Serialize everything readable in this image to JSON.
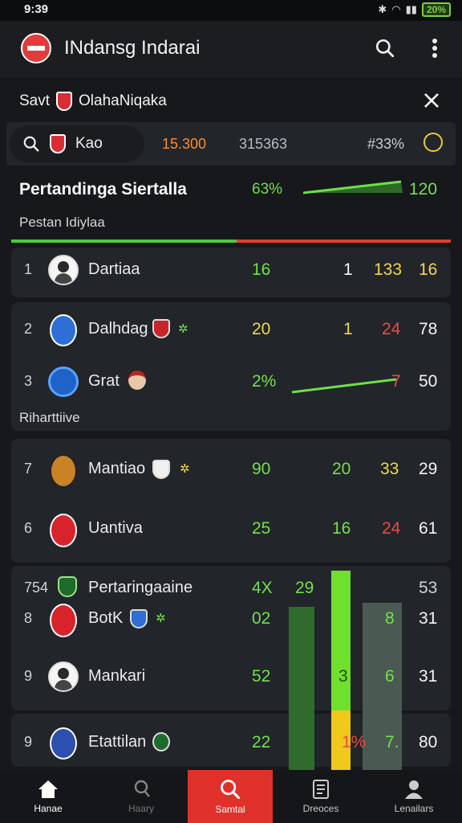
{
  "status_bar": {
    "time": "9:39",
    "battery": "20%"
  },
  "app_bar": {
    "title": "INdansg Indarai"
  },
  "sub_bar": {
    "title_left": "Savt",
    "title_right": "OlahaNiqaka"
  },
  "search": {
    "query": "Kao",
    "values": [
      "15.300",
      "315363",
      "#33%"
    ]
  },
  "leader": {
    "title": "Pertandinga Siertalla",
    "pct": "63%",
    "value": "120",
    "subtitle": "Pestan Idiylaa"
  },
  "rows": [
    {
      "rank": "1",
      "name": "Dartiaa",
      "c1": "16",
      "c2": "1",
      "c3": "133",
      "c4": "16"
    },
    {
      "rank": "2",
      "name": "Dalhdag",
      "c1": "20",
      "c2": "1",
      "c3": "24",
      "c4": "78"
    },
    {
      "rank": "3",
      "name": "Grat",
      "c1": "2%",
      "c3": "7",
      "c4": "50"
    },
    {
      "rank": "7",
      "name": "Mantiao",
      "c1": "90",
      "c2": "20",
      "c3": "33",
      "c4": "29"
    },
    {
      "rank": "6",
      "name": "Uantiva",
      "c1": "25",
      "c2": "16",
      "c3": "24",
      "c4": "61"
    },
    {
      "rank": "754",
      "name": "Pertaringaaine",
      "c1": "4X",
      "c2": "29",
      "c4": "53"
    },
    {
      "rank": "8",
      "name": "BotK",
      "c1": "02",
      "c3": "8",
      "c4": "31"
    },
    {
      "rank": "9",
      "name": "Mankari",
      "c1": "52",
      "c2": "3",
      "c3": "6",
      "c4": "31"
    },
    {
      "rank": "9",
      "name": "Etattilan",
      "c1": "22",
      "c2": "1%",
      "c3": "7.",
      "c4": "80"
    }
  ],
  "section_label": "Riharttiive",
  "bars": {
    "col1_fill": 0.81,
    "col2_fill": 0.99,
    "col3_fill": 0.83
  },
  "nav": [
    {
      "label": "Hanae",
      "icon": "home-icon"
    },
    {
      "label": "Haary",
      "icon": "user-icon"
    },
    {
      "label": "Samtal",
      "icon": "search-icon"
    },
    {
      "label": "Dreoces",
      "icon": "document-icon"
    },
    {
      "label": "Lenailars",
      "icon": "person-icon"
    }
  ]
}
